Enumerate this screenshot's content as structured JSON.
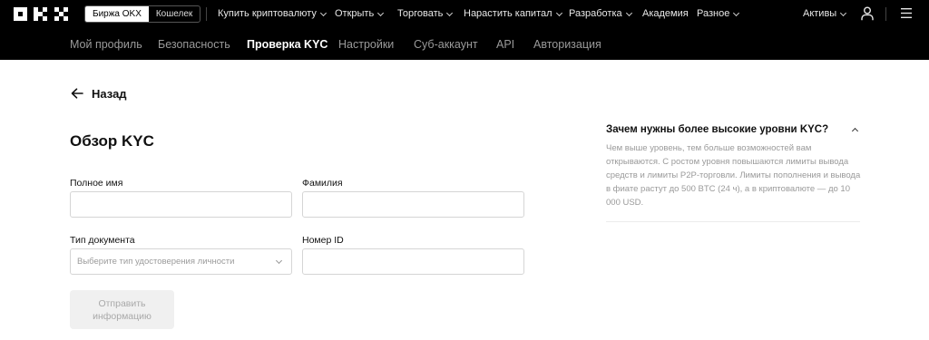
{
  "header": {
    "logo_text": "OKX",
    "mode_switch": {
      "exchange": "Биржа OKX",
      "wallet": "Кошелек"
    },
    "nav": [
      {
        "label": "Купить криптовалюту",
        "icon": "chevron-down-icon"
      },
      {
        "label": "Открыть",
        "icon": "chevron-down-icon"
      },
      {
        "label": "Торговать",
        "icon": "chevron-down-icon"
      },
      {
        "label": "Нарастить капитал",
        "icon": "chevron-down-icon"
      },
      {
        "label": "Разработка",
        "icon": "chevron-down-icon"
      },
      {
        "label": "Академия"
      },
      {
        "label": "Разное",
        "icon": "chevron-down-icon"
      }
    ],
    "assets": {
      "label": "Активы",
      "icon": "chevron-down-icon"
    },
    "icons": {
      "user": "user-icon",
      "menu": "menu-icon"
    }
  },
  "subnav": {
    "items": [
      {
        "label": "Мой профиль"
      },
      {
        "label": "Безопасность"
      },
      {
        "label": "Проверка KYC",
        "active": true
      },
      {
        "label": "Настройки"
      },
      {
        "label": "Суб-аккаунт"
      },
      {
        "label": "API"
      },
      {
        "label": "Авторизация"
      }
    ]
  },
  "main": {
    "back_label": "Назад",
    "back_icon": "arrow-left-icon",
    "title": "Обзор KYC",
    "form": {
      "full_name": {
        "label": "Полное имя",
        "value": ""
      },
      "last_name": {
        "label": "Фамилия",
        "value": ""
      },
      "doc_type": {
        "label": "Тип документа",
        "placeholder": "Выберите тип удостоверения личности"
      },
      "id_number": {
        "label": "Номер ID",
        "value": ""
      },
      "submit_label": "Отправить информацию"
    }
  },
  "faq": {
    "title": "Зачем нужны более высокие уровни KYC?",
    "text": "Чем выше уровень, тем больше возможностей вам открываются. С ростом уровня повышаются лимиты вывода средств и лимиты P2P-торговли. Лимиты пополнения и вывода в фиате растут до 500 BTC (24 ч), а в криптовалюте — до 10 000 USD.",
    "icon": "chevron-up-icon"
  },
  "colors": {
    "topbar_bg": "#000000",
    "subnav_active": "#ffffff",
    "subnav_inactive": "#9a9a9a",
    "muted_text": "#9a9a9a"
  }
}
